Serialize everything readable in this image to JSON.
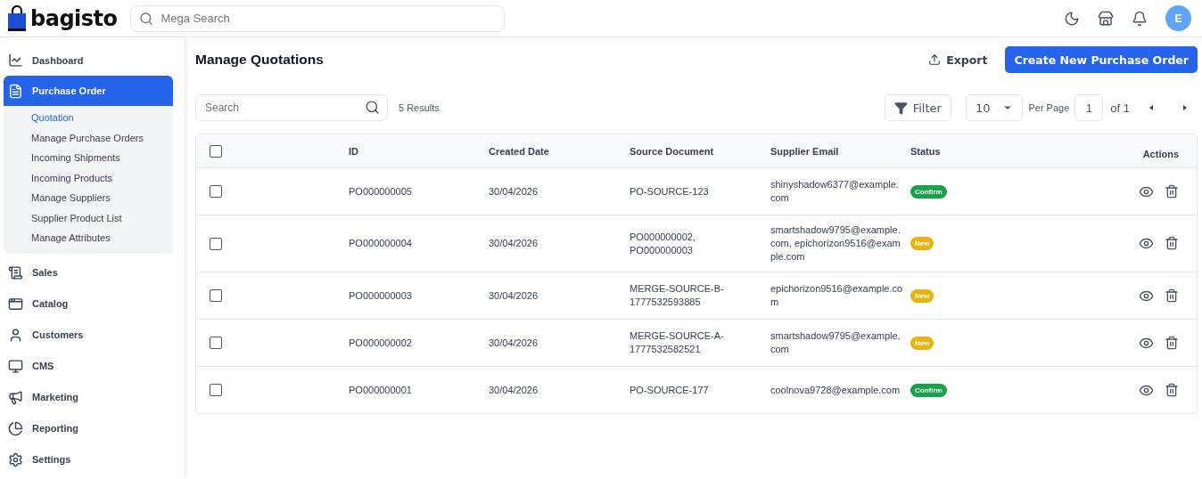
{
  "header": {
    "logo": "bagisto",
    "search": {
      "placeholder": "Mega Search"
    },
    "avatar": "E"
  },
  "sidebar": {
    "items": [
      {
        "label": "Dashboard",
        "selected": false
      },
      {
        "label": "Purchase Order",
        "selected": true,
        "expanded": true,
        "children": [
          {
            "label": "Quotation",
            "selected": true
          },
          {
            "label": "Manage Purchase Orders",
            "selected": false
          },
          {
            "label": "Incoming Shipments",
            "selected": false
          },
          {
            "label": "Incoming Products",
            "selected": false
          },
          {
            "label": "Manage Suppliers",
            "selected": false
          },
          {
            "label": "Supplier Product List",
            "selected": false
          },
          {
            "label": "Manage Attributes",
            "selected": false
          }
        ]
      },
      {
        "label": "Sales",
        "selected": false
      },
      {
        "label": "Catalog",
        "selected": false
      },
      {
        "label": "Customers",
        "selected": false
      },
      {
        "label": "CMS",
        "selected": false
      },
      {
        "label": "Marketing",
        "selected": false
      },
      {
        "label": "Reporting",
        "selected": false
      },
      {
        "label": "Settings",
        "selected": false
      }
    ]
  },
  "page": {
    "title": "Manage Quotations",
    "export": "Export",
    "create": "Create New Purchase Order"
  },
  "toolbar": {
    "search": {
      "placeholder": "Search"
    },
    "results": "5 Results",
    "filter": "Filter",
    "per_page_value": "10",
    "per_page_label": "Per Page",
    "page": "1",
    "of": "of 1"
  },
  "table": {
    "select_all": {
      "checked": false
    },
    "columns": [
      "ID",
      "Created Date",
      "Source Document",
      "Supplier Email",
      "Status",
      "Actions"
    ],
    "rows": [
      {
        "checked": false,
        "id": "PO000000005",
        "date": "30/04/2026",
        "source": "PO-SOURCE-123",
        "email": "shinyshadow6377@example.com",
        "status": {
          "label": "Confirm",
          "kind": "confirm"
        }
      },
      {
        "checked": false,
        "id": "PO000000004",
        "date": "30/04/2026",
        "source": "PO000000002, PO000000003",
        "email": "smartshadow9795@example.com, epichorizon9516@example.com",
        "status": {
          "label": "New",
          "kind": "new"
        }
      },
      {
        "checked": false,
        "id": "PO000000003",
        "date": "30/04/2026",
        "source": "MERGE-SOURCE-B-1777532593885",
        "email": "epichorizon9516@example.com",
        "status": {
          "label": "New",
          "kind": "new"
        }
      },
      {
        "checked": false,
        "id": "PO000000002",
        "date": "30/04/2026",
        "source": "MERGE-SOURCE-A-1777532582521",
        "email": "smartshadow9795@example.com",
        "status": {
          "label": "New",
          "kind": "new"
        }
      },
      {
        "checked": false,
        "id": "PO000000001",
        "date": "30/04/2026",
        "source": "PO-SOURCE-177",
        "email": "coolnova9728@example.com",
        "status": {
          "label": "Confirm",
          "kind": "confirm"
        }
      }
    ]
  }
}
